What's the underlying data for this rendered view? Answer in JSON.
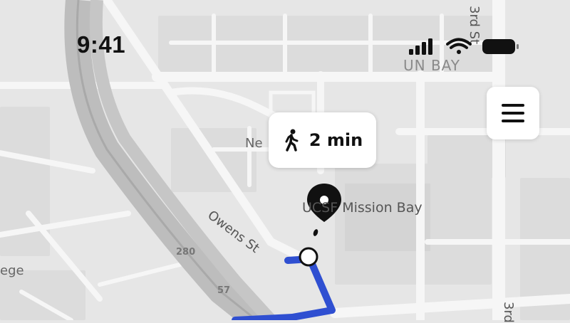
{
  "status_bar": {
    "time": "9:41",
    "icons": [
      "cellular-signal-icon",
      "wifi-icon",
      "battery-icon"
    ]
  },
  "menu_button": {
    "icon": "hamburger-menu-icon"
  },
  "eta_card": {
    "icon": "walking-person-icon",
    "text": "2 min"
  },
  "map": {
    "labels": {
      "place": "UCSF Mission Bay",
      "street_owens": "Owens St",
      "street_top_right": "3rd St",
      "street_bottom_right": "3rd",
      "area_top": "UN BAY",
      "partial_left": "Ne",
      "partial_edge": "ege",
      "highway_280": "280",
      "highway_57": "57"
    }
  },
  "colors": {
    "route": "#2f4fd1",
    "map_background": "#e6e6e6",
    "road": "#f7f7f7",
    "highway": "#b9b9b9",
    "block": "#dcdcdc",
    "pin": "#111111"
  }
}
